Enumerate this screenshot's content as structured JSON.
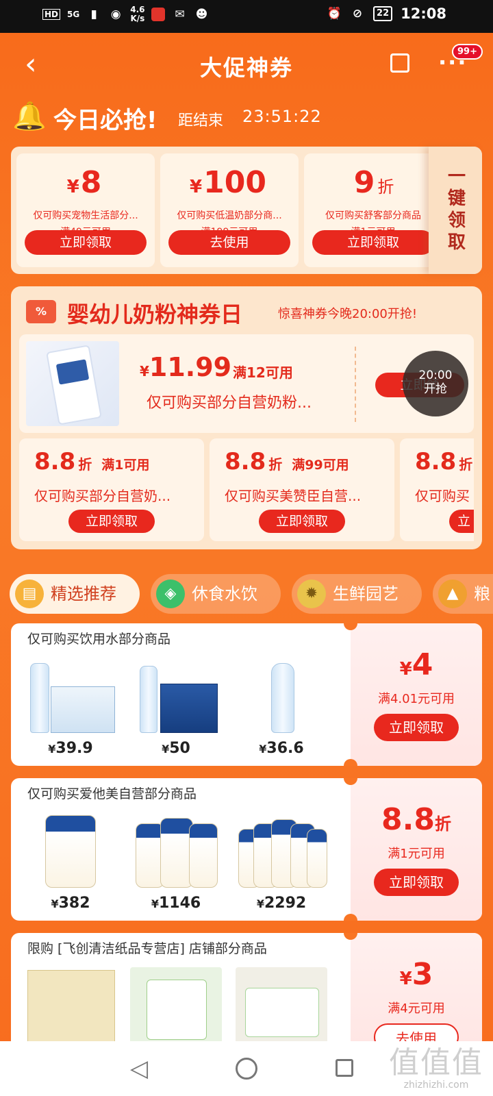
{
  "status_bar": {
    "net_hd": "HD",
    "net_type": "5G",
    "speed": "4.6",
    "speed_unit": "K/s",
    "battery": "22",
    "time": "12:08"
  },
  "nav": {
    "title": "大促神券"
  },
  "notifications": {
    "badge": "99+"
  },
  "today": {
    "title": "今日必抢!",
    "countdown_label": "距结束",
    "countdown": "23:51:22"
  },
  "top_coupons": [
    {
      "currency": "¥",
      "amount": "8",
      "unit": "",
      "desc": "仅可购买宠物生活部分...",
      "cond": "满49元可用",
      "btn": "立即领取"
    },
    {
      "currency": "¥",
      "amount": "100",
      "unit": "",
      "desc": "仅可购买低温奶部分商...",
      "cond": "满199元可用",
      "btn": "去使用"
    },
    {
      "currency": "",
      "amount": "9",
      "unit": "折",
      "desc": "仅可购买舒客部分商品",
      "cond": "满1元可用",
      "btn": "立即领取"
    }
  ],
  "one_key": "一键领取",
  "milk_day": {
    "badge": "%",
    "title": "婴幼儿奶粉神券日",
    "subtitle": "惊喜神券今晚20:00开抢!",
    "main": {
      "currency": "¥",
      "price": "11.99",
      "cond": "满12可用",
      "desc": "仅可购买部分自营奶粉...",
      "btn": "立即领",
      "clock_time": "20:00",
      "clock_label": "开抢"
    },
    "subs": [
      {
        "amount": "8.8",
        "unit": "折",
        "cond": "满1可用",
        "desc": "仅可购买部分自营奶...",
        "btn": "立即领取"
      },
      {
        "amount": "8.8",
        "unit": "折",
        "cond": "满99可用",
        "desc": "仅可购买美赞臣自营...",
        "btn": "立即领取"
      },
      {
        "amount": "8.8",
        "unit": "折",
        "cond": "",
        "desc": "仅可购买",
        "btn": "立"
      }
    ]
  },
  "tabs": [
    "精选推荐",
    "休食水饮",
    "生鲜园艺",
    "粮"
  ],
  "product_coupons": [
    {
      "title": "仅可购买饮用水部分商品",
      "prices": [
        "39.9",
        "50",
        "36.6"
      ],
      "currency": "¥",
      "amount": "4",
      "unit": "",
      "cond": "满4.01元可用",
      "btn": "立即领取"
    },
    {
      "title": "仅可购买爱他美自营部分商品",
      "prices": [
        "382",
        "1146",
        "2292"
      ],
      "currency": "",
      "amount": "8.8",
      "unit": "折",
      "cond": "满1元可用",
      "btn": "立即领取"
    },
    {
      "title": "限购 [飞创清洁纸品专营店] 店铺部分商品",
      "prices": [],
      "currency": "¥",
      "amount": "3",
      "unit": "",
      "cond": "满4元可用",
      "btn": "去使用"
    }
  ],
  "watermark": {
    "glyphs": "值值值",
    "site": "zhizhizhi.com"
  },
  "colors": {
    "brand_orange": "#f86d1d",
    "coupon_red": "#e8281e"
  }
}
